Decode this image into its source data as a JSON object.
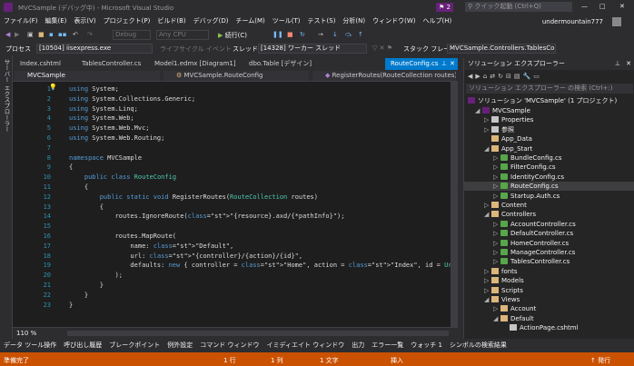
{
  "window": {
    "title": "MVCSample (デバッグ中) - Microsoft Visual Studio",
    "notifications": "2",
    "quick_launch_placeholder": "クイック起動 (Ctrl+Q)",
    "user": "undermountain777",
    "min": "—",
    "max": "□",
    "close": "✕"
  },
  "menu": [
    "ファイル(F)",
    "編集(E)",
    "表示(V)",
    "プロジェクト(P)",
    "ビルド(B)",
    "デバッグ(D)",
    "チーム(M)",
    "ツール(T)",
    "テスト(S)",
    "分析(N)",
    "ウィンドウ(W)",
    "ヘルプ(H)"
  ],
  "toolbar": {
    "config": "Debug",
    "platform": "Any CPU",
    "continue": "続行(C)"
  },
  "debugbar": {
    "process_label": "プロセス",
    "process_value": "[10504] iisexpress.exe",
    "lifecycle": "ライフサイクル イベント",
    "thread_label": "スレッド:",
    "thread_value": "[14328] ワーカー スレッド",
    "stack_label": "スタック フレーム:",
    "stack_value": "MVCSample.Controllers.TablesController.En"
  },
  "left_rail": {
    "label": "サーバー エクスプローラー"
  },
  "tabs": [
    "Index.cshtml",
    "TablesController.cs",
    "Model1.edmx [Diagram1]",
    "dbo.Table [デザイン]",
    "RouteConfig.cs"
  ],
  "nav": {
    "project": "MVCSample",
    "class": "MVCSample.RouteConfig",
    "member": "RegisterRoutes(RouteCollection routes)"
  },
  "code_lines": [
    {
      "n": "1",
      "t": "using System;"
    },
    {
      "n": "2",
      "t": "using System.Collections.Generic;"
    },
    {
      "n": "3",
      "t": "using System.Linq;"
    },
    {
      "n": "4",
      "t": "using System.Web;"
    },
    {
      "n": "5",
      "t": "using System.Web.Mvc;"
    },
    {
      "n": "6",
      "t": "using System.Web.Routing;"
    },
    {
      "n": "7",
      "t": ""
    },
    {
      "n": "8",
      "t": "namespace MVCSample"
    },
    {
      "n": "9",
      "t": "{"
    },
    {
      "n": "10",
      "t": "    public class RouteConfig"
    },
    {
      "n": "11",
      "t": "    {"
    },
    {
      "n": "12",
      "t": "        public static void RegisterRoutes(RouteCollection routes)"
    },
    {
      "n": "13",
      "t": "        {"
    },
    {
      "n": "14",
      "t": "            routes.IgnoreRoute(\"{resource}.axd/{*pathInfo}\");"
    },
    {
      "n": "15",
      "t": ""
    },
    {
      "n": "16",
      "t": "            routes.MapRoute("
    },
    {
      "n": "17",
      "t": "                name: \"Default\","
    },
    {
      "n": "18",
      "t": "                url: \"{controller}/{action}/{id}\","
    },
    {
      "n": "19",
      "t": "                defaults: new { controller = \"Home\", action = \"Index\", id = UrlParameter.Optional }"
    },
    {
      "n": "20",
      "t": "            );"
    },
    {
      "n": "21",
      "t": "        }"
    },
    {
      "n": "22",
      "t": "    }"
    },
    {
      "n": "23",
      "t": "}"
    }
  ],
  "zoom": "110 %",
  "bottom_tabs": [
    "データ ツール操作",
    "呼び出し履歴",
    "ブレークポイント",
    "例外設定",
    "コマンド ウィンドウ",
    "イミディエイト ウィンドウ",
    "出力",
    "エラー一覧",
    "ウォッチ 1",
    "シンボルの検索結果"
  ],
  "status": {
    "ready": "準備完了",
    "line": "1 行",
    "col": "1 列",
    "char": "1 文字",
    "mode": "挿入",
    "publish": "↑ 発行"
  },
  "solution": {
    "title": "ソリューション エクスプローラー",
    "search_placeholder": "ソリューション エクスプローラー の検索 (Ctrl+:)",
    "solution_label": "ソリューション 'MVCSample' (1 プロジェクト)",
    "nodes": [
      {
        "label": "MVCSample",
        "depth": 1,
        "kind": "project",
        "exp": "◢"
      },
      {
        "label": "Properties",
        "depth": 2,
        "kind": "wrench",
        "exp": "▷"
      },
      {
        "label": "参照",
        "depth": 2,
        "kind": "ref",
        "exp": "▷"
      },
      {
        "label": "App_Data",
        "depth": 2,
        "kind": "folder",
        "exp": ""
      },
      {
        "label": "App_Start",
        "depth": 2,
        "kind": "folder",
        "exp": "◢"
      },
      {
        "label": "BundleConfig.cs",
        "depth": 3,
        "kind": "cs",
        "exp": "▷"
      },
      {
        "label": "FilterConfig.cs",
        "depth": 3,
        "kind": "cs",
        "exp": "▷"
      },
      {
        "label": "IdentityConfig.cs",
        "depth": 3,
        "kind": "cs",
        "exp": "▷"
      },
      {
        "label": "RouteConfig.cs",
        "depth": 3,
        "kind": "cs",
        "exp": "▷",
        "sel": true
      },
      {
        "label": "Startup.Auth.cs",
        "depth": 3,
        "kind": "cs",
        "exp": "▷"
      },
      {
        "label": "Content",
        "depth": 2,
        "kind": "folder",
        "exp": "▷"
      },
      {
        "label": "Controllers",
        "depth": 2,
        "kind": "folder",
        "exp": "◢"
      },
      {
        "label": "AccountController.cs",
        "depth": 3,
        "kind": "cs",
        "exp": "▷"
      },
      {
        "label": "DefaultController.cs",
        "depth": 3,
        "kind": "cs",
        "exp": "▷"
      },
      {
        "label": "HomeController.cs",
        "depth": 3,
        "kind": "cs",
        "exp": "▷"
      },
      {
        "label": "ManageController.cs",
        "depth": 3,
        "kind": "cs",
        "exp": "▷"
      },
      {
        "label": "TablesController.cs",
        "depth": 3,
        "kind": "cs",
        "exp": "▷"
      },
      {
        "label": "fonts",
        "depth": 2,
        "kind": "folder",
        "exp": "▷"
      },
      {
        "label": "Models",
        "depth": 2,
        "kind": "folder",
        "exp": "▷"
      },
      {
        "label": "Scripts",
        "depth": 2,
        "kind": "folder",
        "exp": "▷"
      },
      {
        "label": "Views",
        "depth": 2,
        "kind": "folder",
        "exp": "◢"
      },
      {
        "label": "Account",
        "depth": 3,
        "kind": "folder",
        "exp": "▷"
      },
      {
        "label": "Default",
        "depth": 3,
        "kind": "folder",
        "exp": "◢"
      },
      {
        "label": "ActionPage.cshtml",
        "depth": 4,
        "kind": "file",
        "exp": ""
      }
    ]
  },
  "colors": {
    "accent": "#007acc",
    "status": "#ca5100",
    "bg": "#2d2d30"
  }
}
